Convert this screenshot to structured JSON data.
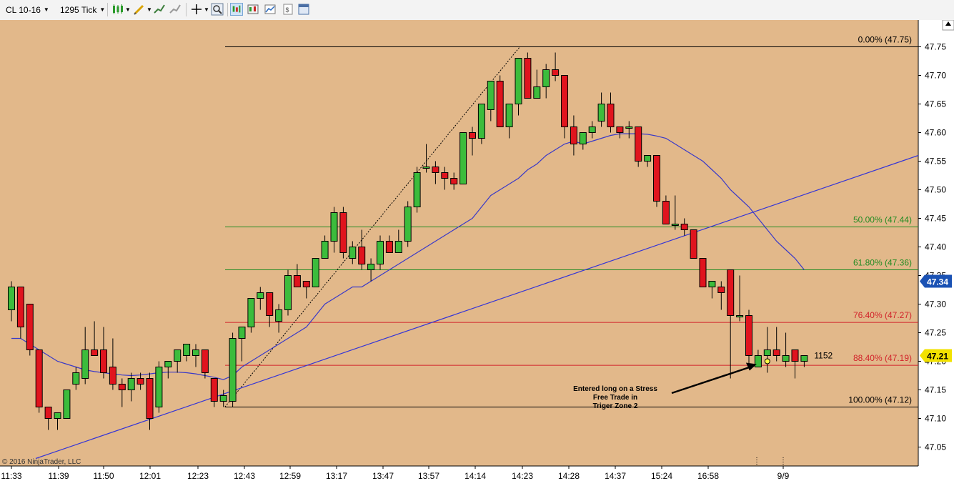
{
  "toolbar": {
    "instrument": "CL 10-16",
    "interval": "1295 Tick",
    "icons": [
      "bar-type-icon",
      "drawing-tool-icon",
      "indicator-icon",
      "strategy-icon",
      "crosshair-icon",
      "zoom-icon",
      "chart-trader-icon",
      "data-box-icon",
      "chart-style-icon",
      "properties-icon",
      "window-layout-icon"
    ]
  },
  "colors": {
    "background": "#e2b88a",
    "up_bar": "#3cbc3c",
    "down_bar": "#e0141e",
    "ma_line": "#3939c8",
    "trend_line": "#3535d6",
    "fib_green": "#228b22",
    "fib_red": "#d2222a",
    "fib_black": "#000000"
  },
  "chart_data": {
    "type": "candlestick",
    "instrument": "CL 10-16",
    "interval": "1295 Tick",
    "x_tick_labels": [
      "11:33",
      "11:39",
      "11:50",
      "12:01",
      "12:23",
      "12:43",
      "12:59",
      "13:17",
      "13:47",
      "13:57",
      "14:14",
      "14:23",
      "14:28",
      "14:37",
      "15:24",
      "16:58",
      "9/9"
    ],
    "y_tick_labels": [
      "47.75",
      "47.70",
      "47.65",
      "47.60",
      "47.55",
      "47.50",
      "47.45",
      "47.40",
      "47.35",
      "47.30",
      "47.25",
      "47.20",
      "47.15",
      "47.10",
      "47.05"
    ],
    "ylim": [
      47.015,
      47.79
    ],
    "candles": [
      {
        "o": 47.29,
        "h": 47.34,
        "l": 47.27,
        "c": 47.33
      },
      {
        "o": 47.33,
        "h": 47.33,
        "l": 47.24,
        "c": 47.26
      },
      {
        "o": 47.3,
        "h": 47.3,
        "l": 47.21,
        "c": 47.22
      },
      {
        "o": 47.22,
        "h": 47.22,
        "l": 47.11,
        "c": 47.12
      },
      {
        "o": 47.12,
        "h": 47.12,
        "l": 47.08,
        "c": 47.1
      },
      {
        "o": 47.1,
        "h": 47.11,
        "l": 47.08,
        "c": 47.11
      },
      {
        "o": 47.1,
        "h": 47.15,
        "l": 47.1,
        "c": 47.15
      },
      {
        "o": 47.16,
        "h": 47.19,
        "l": 47.15,
        "c": 47.18
      },
      {
        "o": 47.17,
        "h": 47.26,
        "l": 47.16,
        "c": 47.22
      },
      {
        "o": 47.22,
        "h": 47.27,
        "l": 47.21,
        "c": 47.21
      },
      {
        "o": 47.22,
        "h": 47.26,
        "l": 47.17,
        "c": 47.18
      },
      {
        "o": 47.19,
        "h": 47.24,
        "l": 47.15,
        "c": 47.16
      },
      {
        "o": 47.16,
        "h": 47.17,
        "l": 47.12,
        "c": 47.15
      },
      {
        "o": 47.15,
        "h": 47.18,
        "l": 47.13,
        "c": 47.17
      },
      {
        "o": 47.17,
        "h": 47.18,
        "l": 47.15,
        "c": 47.16
      },
      {
        "o": 47.17,
        "h": 47.18,
        "l": 47.08,
        "c": 47.1
      },
      {
        "o": 47.12,
        "h": 47.2,
        "l": 47.11,
        "c": 47.19
      },
      {
        "o": 47.19,
        "h": 47.2,
        "l": 47.17,
        "c": 47.2
      },
      {
        "o": 47.2,
        "h": 47.22,
        "l": 47.18,
        "c": 47.22
      },
      {
        "o": 47.21,
        "h": 47.23,
        "l": 47.2,
        "c": 47.23
      },
      {
        "o": 47.21,
        "h": 47.23,
        "l": 47.19,
        "c": 47.22
      },
      {
        "o": 47.22,
        "h": 47.22,
        "l": 47.17,
        "c": 47.18
      },
      {
        "o": 47.17,
        "h": 47.17,
        "l": 47.12,
        "c": 47.13
      },
      {
        "o": 47.13,
        "h": 47.15,
        "l": 47.12,
        "c": 47.14
      },
      {
        "o": 47.13,
        "h": 47.25,
        "l": 47.12,
        "c": 47.24
      },
      {
        "o": 47.24,
        "h": 47.26,
        "l": 47.2,
        "c": 47.26
      },
      {
        "o": 47.26,
        "h": 47.31,
        "l": 47.25,
        "c": 47.31
      },
      {
        "o": 47.31,
        "h": 47.33,
        "l": 47.29,
        "c": 47.32
      },
      {
        "o": 47.32,
        "h": 47.32,
        "l": 47.26,
        "c": 47.28
      },
      {
        "o": 47.27,
        "h": 47.3,
        "l": 47.25,
        "c": 47.29
      },
      {
        "o": 47.29,
        "h": 47.36,
        "l": 47.28,
        "c": 47.35
      },
      {
        "o": 47.35,
        "h": 47.37,
        "l": 47.33,
        "c": 47.33
      },
      {
        "o": 47.34,
        "h": 47.34,
        "l": 47.31,
        "c": 47.33
      },
      {
        "o": 47.33,
        "h": 47.38,
        "l": 47.33,
        "c": 47.38
      },
      {
        "o": 47.38,
        "h": 47.42,
        "l": 47.38,
        "c": 47.41
      },
      {
        "o": 47.41,
        "h": 47.47,
        "l": 47.39,
        "c": 47.46
      },
      {
        "o": 47.46,
        "h": 47.47,
        "l": 47.38,
        "c": 47.39
      },
      {
        "o": 47.38,
        "h": 47.41,
        "l": 47.37,
        "c": 47.4
      },
      {
        "o": 47.4,
        "h": 47.43,
        "l": 47.36,
        "c": 47.37
      },
      {
        "o": 47.36,
        "h": 47.38,
        "l": 47.34,
        "c": 47.37
      },
      {
        "o": 47.37,
        "h": 47.42,
        "l": 47.36,
        "c": 47.41
      },
      {
        "o": 47.41,
        "h": 47.42,
        "l": 47.39,
        "c": 47.39
      },
      {
        "o": 47.39,
        "h": 47.43,
        "l": 47.39,
        "c": 47.41
      },
      {
        "o": 47.41,
        "h": 47.48,
        "l": 47.4,
        "c": 47.47
      },
      {
        "o": 47.47,
        "h": 47.54,
        "l": 47.46,
        "c": 47.53
      },
      {
        "o": 47.54,
        "h": 47.58,
        "l": 47.53,
        "c": 47.54
      },
      {
        "o": 47.54,
        "h": 47.55,
        "l": 47.51,
        "c": 47.53
      },
      {
        "o": 47.53,
        "h": 47.54,
        "l": 47.5,
        "c": 47.52
      },
      {
        "o": 47.52,
        "h": 47.53,
        "l": 47.5,
        "c": 47.51
      },
      {
        "o": 47.51,
        "h": 47.6,
        "l": 47.51,
        "c": 47.6
      },
      {
        "o": 47.6,
        "h": 47.61,
        "l": 47.56,
        "c": 47.59
      },
      {
        "o": 47.59,
        "h": 47.65,
        "l": 47.58,
        "c": 47.65
      },
      {
        "o": 47.64,
        "h": 47.69,
        "l": 47.62,
        "c": 47.69
      },
      {
        "o": 47.69,
        "h": 47.7,
        "l": 47.61,
        "c": 47.61
      },
      {
        "o": 47.61,
        "h": 47.65,
        "l": 47.59,
        "c": 47.65
      },
      {
        "o": 47.65,
        "h": 47.73,
        "l": 47.63,
        "c": 47.73
      },
      {
        "o": 47.73,
        "h": 47.74,
        "l": 47.66,
        "c": 47.66
      },
      {
        "o": 47.66,
        "h": 47.71,
        "l": 47.66,
        "c": 47.68
      },
      {
        "o": 47.68,
        "h": 47.72,
        "l": 47.66,
        "c": 47.71
      },
      {
        "o": 47.71,
        "h": 47.74,
        "l": 47.69,
        "c": 47.7
      },
      {
        "o": 47.7,
        "h": 47.7,
        "l": 47.59,
        "c": 47.61
      },
      {
        "o": 47.61,
        "h": 47.63,
        "l": 47.56,
        "c": 47.58
      },
      {
        "o": 47.58,
        "h": 47.6,
        "l": 47.57,
        "c": 47.6
      },
      {
        "o": 47.6,
        "h": 47.62,
        "l": 47.59,
        "c": 47.61
      },
      {
        "o": 47.62,
        "h": 47.67,
        "l": 47.61,
        "c": 47.65
      },
      {
        "o": 47.65,
        "h": 47.67,
        "l": 47.6,
        "c": 47.61
      },
      {
        "o": 47.61,
        "h": 47.61,
        "l": 47.59,
        "c": 47.6
      },
      {
        "o": 47.61,
        "h": 47.62,
        "l": 47.59,
        "c": 47.61
      },
      {
        "o": 47.61,
        "h": 47.61,
        "l": 47.54,
        "c": 47.55
      },
      {
        "o": 47.55,
        "h": 47.56,
        "l": 47.54,
        "c": 47.56
      },
      {
        "o": 47.56,
        "h": 47.56,
        "l": 47.47,
        "c": 47.48
      },
      {
        "o": 47.48,
        "h": 47.49,
        "l": 47.44,
        "c": 47.44
      },
      {
        "o": 47.44,
        "h": 47.49,
        "l": 47.43,
        "c": 47.44
      },
      {
        "o": 47.44,
        "h": 47.45,
        "l": 47.42,
        "c": 47.43
      },
      {
        "o": 47.43,
        "h": 47.43,
        "l": 47.38,
        "c": 47.38
      },
      {
        "o": 47.38,
        "h": 47.38,
        "l": 47.33,
        "c": 47.33
      },
      {
        "o": 47.33,
        "h": 47.34,
        "l": 47.31,
        "c": 47.34
      },
      {
        "o": 47.33,
        "h": 47.34,
        "l": 47.29,
        "c": 47.32
      },
      {
        "o": 47.36,
        "h": 47.36,
        "l": 47.17,
        "c": 47.28
      },
      {
        "o": 47.28,
        "h": 47.35,
        "l": 47.27,
        "c": 47.28
      },
      {
        "o": 47.28,
        "h": 47.29,
        "l": 47.19,
        "c": 47.21
      },
      {
        "o": 47.19,
        "h": 47.22,
        "l": 47.19,
        "c": 47.21
      },
      {
        "o": 47.21,
        "h": 47.26,
        "l": 47.18,
        "c": 47.22
      },
      {
        "o": 47.22,
        "h": 47.26,
        "l": 47.2,
        "c": 47.21
      },
      {
        "o": 47.2,
        "h": 47.25,
        "l": 47.19,
        "c": 47.21
      },
      {
        "o": 47.22,
        "h": 47.22,
        "l": 47.17,
        "c": 47.2
      },
      {
        "o": 47.2,
        "h": 47.21,
        "l": 47.19,
        "c": 47.21
      }
    ],
    "moving_average": [
      47.24,
      47.24,
      47.23,
      47.22,
      47.21,
      47.2,
      47.195,
      47.19,
      47.185,
      47.182,
      47.18,
      47.178,
      47.176,
      47.175,
      47.176,
      47.178,
      47.18,
      47.181,
      47.181,
      47.18,
      47.178,
      47.175,
      47.172,
      47.168,
      47.175,
      47.19,
      47.2,
      47.21,
      47.22,
      47.23,
      47.24,
      47.25,
      47.26,
      47.28,
      47.3,
      47.31,
      47.32,
      47.33,
      47.33,
      47.34,
      47.35,
      47.36,
      47.37,
      47.38,
      47.39,
      47.4,
      47.41,
      47.42,
      47.43,
      47.44,
      47.45,
      47.47,
      47.49,
      47.5,
      47.51,
      47.52,
      47.535,
      47.545,
      47.56,
      47.57,
      47.58,
      47.585,
      47.58,
      47.585,
      47.59,
      47.595,
      47.598,
      47.598,
      47.598,
      47.597,
      47.594,
      47.59,
      47.58,
      47.57,
      47.56,
      47.55,
      47.535,
      47.52,
      47.5,
      47.485,
      47.47,
      47.45,
      47.43,
      47.41,
      47.395,
      47.38,
      47.36
    ],
    "fibonacci": [
      {
        "label": "0.00% (47.75)",
        "price": 47.75,
        "color": "black"
      },
      {
        "label": "50.00% (47.44)",
        "price": 47.435,
        "color": "green"
      },
      {
        "label": "61.80% (47.36)",
        "price": 47.36,
        "color": "green"
      },
      {
        "label": "76.40% (47.27)",
        "price": 47.268,
        "color": "red"
      },
      {
        "label": "88.40% (47.19)",
        "price": 47.193,
        "color": "red"
      },
      {
        "label": "100.00% (47.12)",
        "price": 47.12,
        "color": "black"
      }
    ],
    "fib_anchor": {
      "start_price": 47.12,
      "end_price": 47.75
    },
    "trend_line": {
      "start_price": 47.03,
      "end_price": 47.56
    },
    "price_markers": [
      {
        "label": "47.34",
        "price": 47.34
      },
      {
        "label": "47.21",
        "price": 47.21
      }
    ],
    "entry_marker": {
      "price": 47.2
    },
    "volume_label": "1152",
    "annotation": {
      "lines": [
        "Entered long on a Stress",
        "Free Trade in",
        "Triger Zone 2"
      ],
      "arrow_target_price": 47.195
    },
    "copyright": "© 2016 NinjaTrader, LLC",
    "grid": false
  }
}
